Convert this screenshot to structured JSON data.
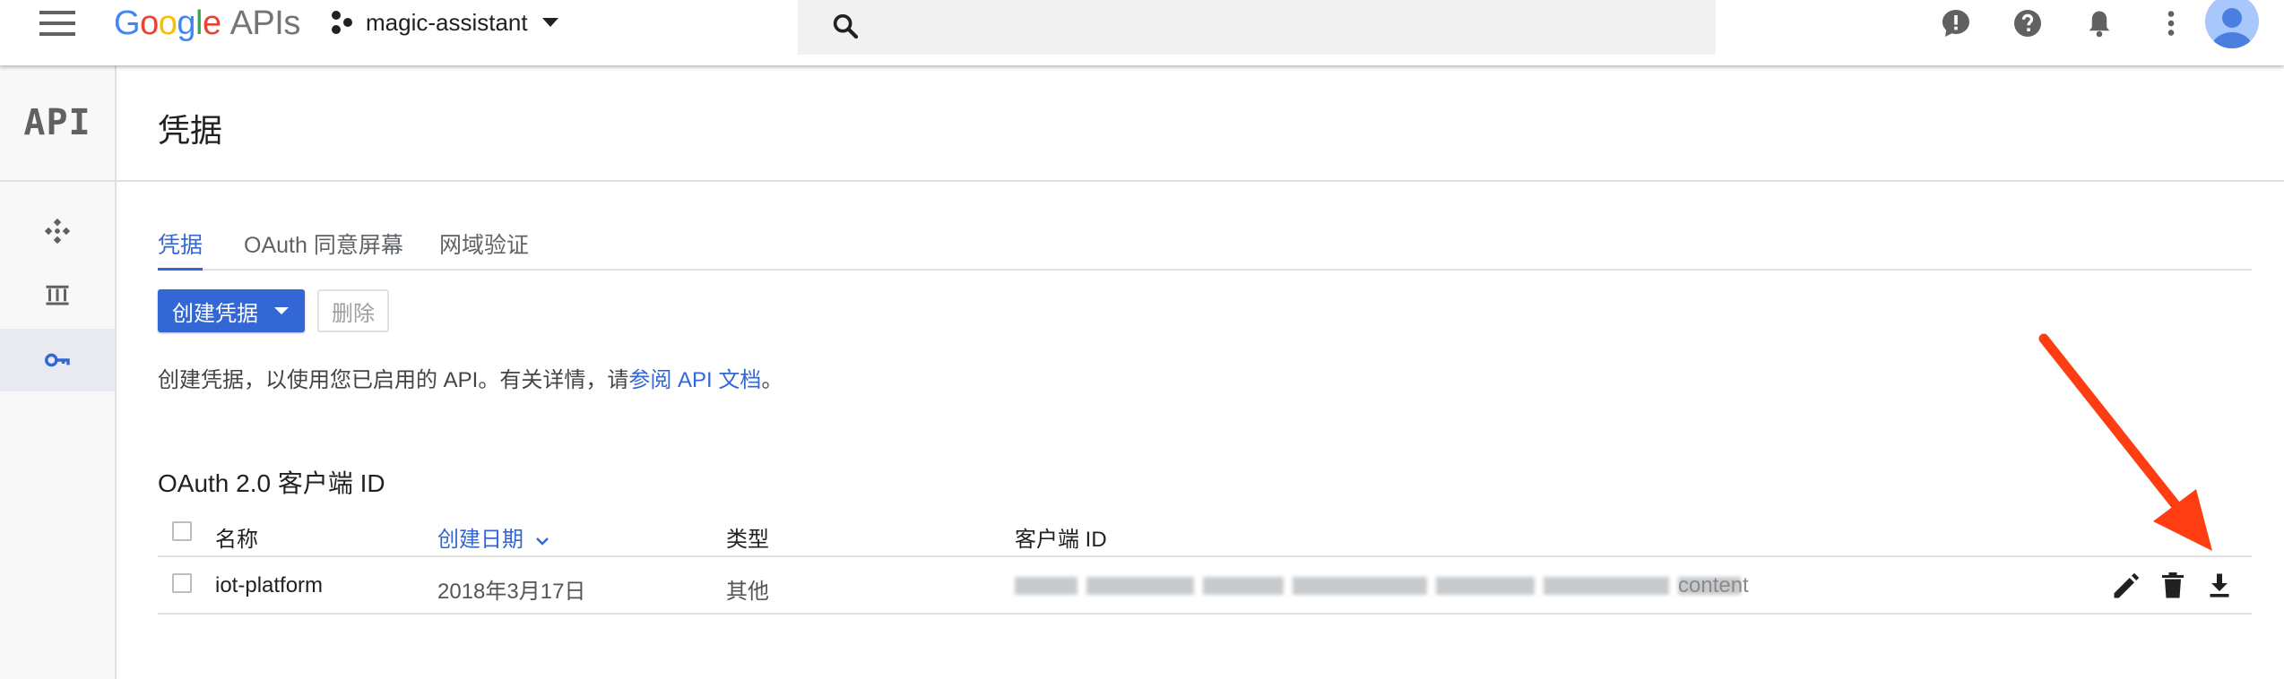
{
  "header": {
    "logo_letters": [
      "G",
      "o",
      "o",
      "g",
      "l",
      "e"
    ],
    "logo_suffix": "APIs",
    "project_name": "magic-assistant",
    "search_placeholder": ""
  },
  "icons": {
    "menu": "menu-icon",
    "project": "project-hierarchy-icon",
    "search": "search-icon",
    "feedback": "feedback-icon",
    "help": "help-icon",
    "notifications": "notifications-icon",
    "more": "more-vert-icon",
    "account": "account-avatar"
  },
  "sidebar": {
    "logo_text": "API",
    "items": [
      {
        "icon": "dashboard-icon",
        "active": false
      },
      {
        "icon": "library-icon",
        "active": false
      },
      {
        "icon": "key-icon",
        "active": true
      }
    ]
  },
  "page": {
    "title": "凭据",
    "tabs": [
      {
        "label": "凭据",
        "active": true
      },
      {
        "label": "OAuth 同意屏幕",
        "active": false
      },
      {
        "label": "网域验证",
        "active": false
      }
    ],
    "create_button": "创建凭据",
    "delete_button": "删除",
    "description_prefix": "创建凭据，以使用您已启用的 API。有关详情，请",
    "description_link": "参阅 API 文档",
    "description_suffix": "。"
  },
  "oauth_section": {
    "title": "OAuth 2.0 客户端 ID",
    "columns": {
      "name": "名称",
      "created": "创建日期",
      "type": "类型",
      "client_id": "客户端 ID"
    },
    "rows": [
      {
        "name": "iot-platform",
        "created": "2018年3月17日",
        "type": "其他",
        "client_id_visible_tail": "content",
        "actions": [
          "edit-icon",
          "delete-icon",
          "download-icon"
        ]
      }
    ]
  },
  "colors": {
    "accent": "#3367d6",
    "annotation_arrow": "#ff3d12"
  }
}
